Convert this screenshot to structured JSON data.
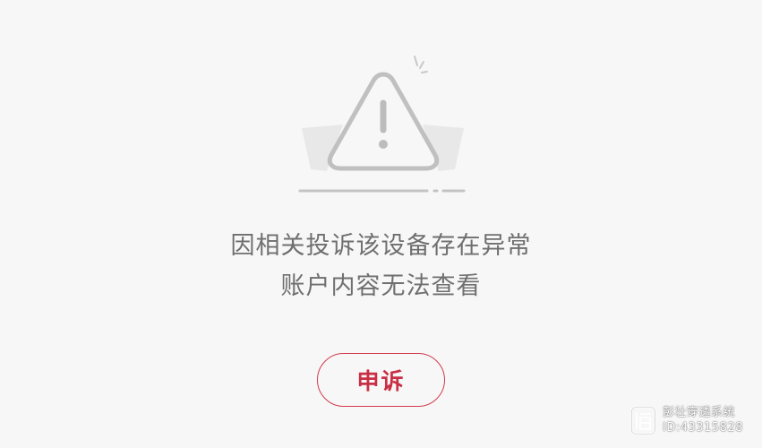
{
  "colors": {
    "background": "#f7f7f7",
    "message_text": "#6f6f6f",
    "accent": "#c92f44",
    "illustration_stroke": "#bdbdbd",
    "illustration_fill": "#e6e6e6"
  },
  "illustration": {
    "icon": "warning-triangle-icon"
  },
  "message": {
    "line1": "因相关投诉该设备存在异常",
    "line2": "账户内容无法查看"
  },
  "appeal_button": {
    "label": "申诉"
  },
  "watermark": {
    "logo_icon": "watermark-logo-icon",
    "line1": "彭壮穿透系统",
    "line2": "ID:43315828"
  }
}
